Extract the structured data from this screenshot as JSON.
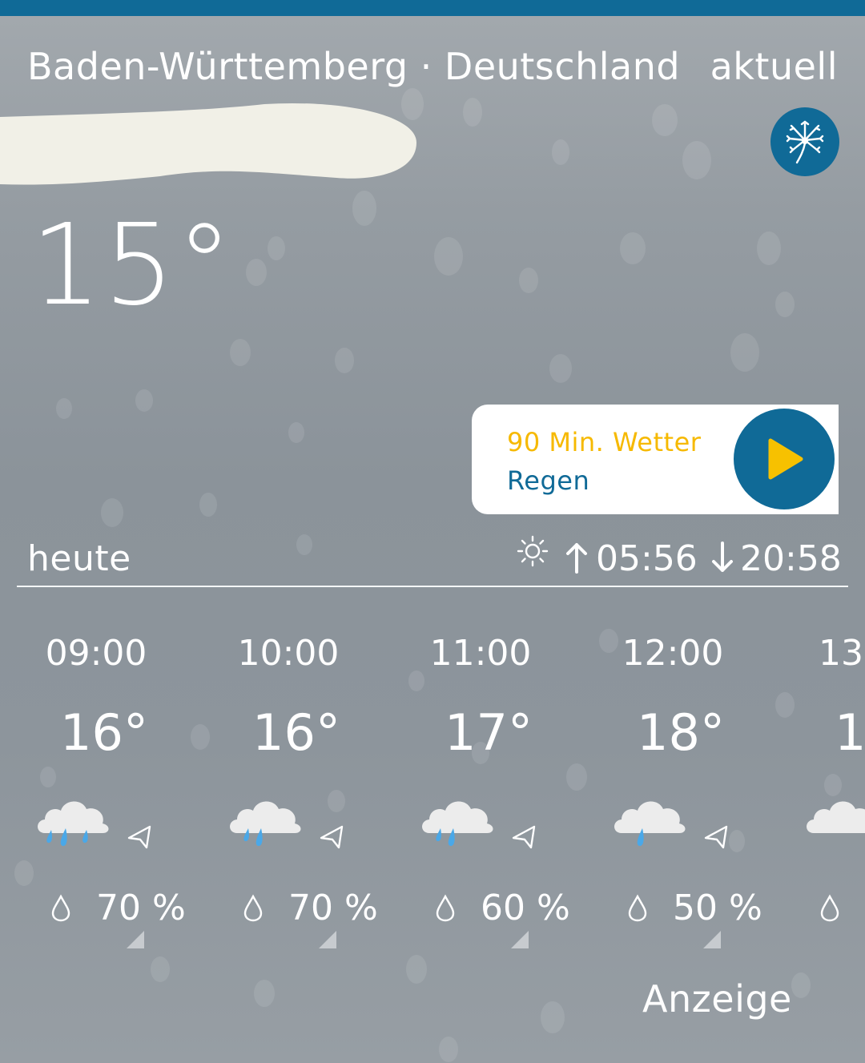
{
  "header": {
    "region": "Baden-Württemberg · Deutschland",
    "status": "aktuell",
    "pollen_icon": "dandelion-icon"
  },
  "current": {
    "temperature": "15°"
  },
  "nowcast": {
    "title": "90 Min. Wetter",
    "condition": "Regen",
    "play_icon": "play-icon"
  },
  "today": {
    "label": "heute",
    "sunrise": "05:56",
    "sunset": "20:58"
  },
  "hourly": [
    {
      "time": "09:00",
      "temp": "16°",
      "precip": "70 %",
      "icon": "cloud-heavy-rain-icon"
    },
    {
      "time": "10:00",
      "temp": "16°",
      "precip": "70 %",
      "icon": "cloud-rain-icon"
    },
    {
      "time": "11:00",
      "temp": "17°",
      "precip": "60 %",
      "icon": "cloud-rain-icon"
    },
    {
      "time": "12:00",
      "temp": "18°",
      "precip": "50 %",
      "icon": "cloud-light-rain-icon"
    },
    {
      "time": "13:",
      "temp": "1",
      "precip": "",
      "icon": "cloud-icon"
    }
  ],
  "ad_label": "Anzeige",
  "colors": {
    "accent_blue": "#106a97",
    "nowcast_yellow": "#f6b900",
    "play_yellow": "#f7c100",
    "rain_blue": "#4aa8e8"
  }
}
